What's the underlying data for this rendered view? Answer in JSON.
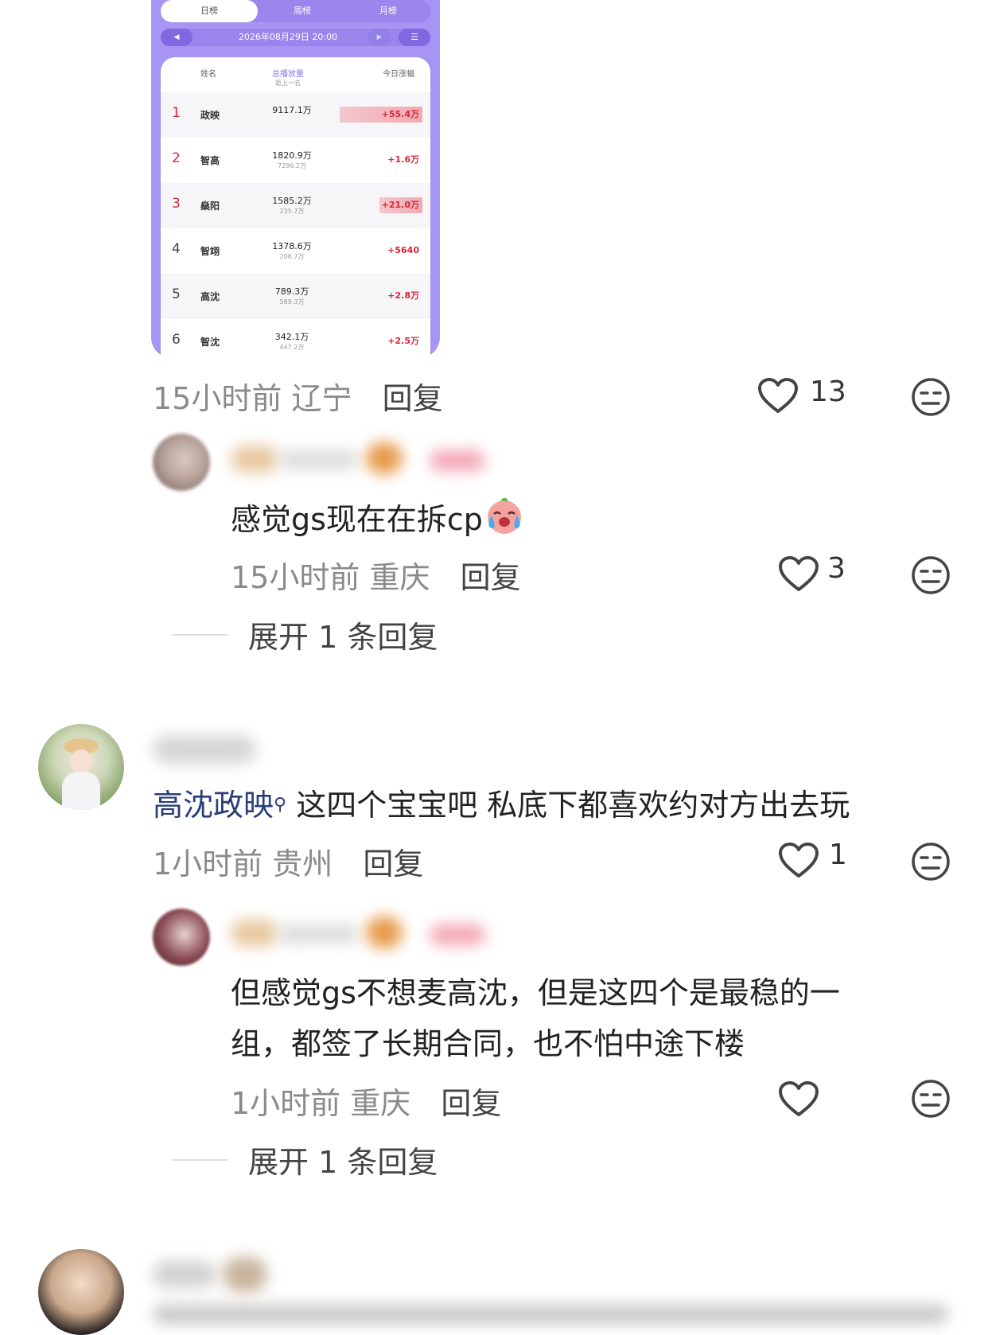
{
  "ranking_card": {
    "tabs": {
      "day": "日榜",
      "week": "周榜",
      "month": "月榜"
    },
    "date": "2026年08月29日 20:00",
    "headers": {
      "name": "姓名",
      "total": "总播放量",
      "total_sub": "距上一名",
      "today": "今日涨幅"
    },
    "rows": [
      {
        "rank": "1",
        "name": "政映",
        "total": "9117.1万",
        "gap": "",
        "today": "+55.4万"
      },
      {
        "rank": "2",
        "name": "智高",
        "total": "1820.9万",
        "gap": "7296.2万",
        "today": "+1.6万"
      },
      {
        "rank": "3",
        "name": "燊阳",
        "total": "1585.2万",
        "gap": "235.7万",
        "today": "+21.0万"
      },
      {
        "rank": "4",
        "name": "智翊",
        "total": "1378.6万",
        "gap": "206.7万",
        "today": "+5640"
      },
      {
        "rank": "5",
        "name": "高沈",
        "total": "789.3万",
        "gap": "589.3万",
        "today": "+2.8万"
      },
      {
        "rank": "6",
        "name": "智沈",
        "total": "342.1万",
        "gap": "447.2万",
        "today": "+2.5万"
      }
    ]
  },
  "comments": {
    "c1": {
      "time": "15小时前",
      "location": "辽宁",
      "reply": "回复",
      "likes": "13"
    },
    "r1": {
      "text": "感觉gs现在在拆cp",
      "time": "15小时前",
      "location": "重庆",
      "reply": "回复",
      "likes": "3"
    },
    "expand1": "展开 1 条回复",
    "c2": {
      "mention": "高沈政映",
      "text": " 这四个宝宝吧 私底下都喜欢约对方出去玩",
      "time": "1小时前",
      "location": "贵州",
      "reply": "回复",
      "likes": "1"
    },
    "r2": {
      "line1": "但感觉gs不想麦高沈，但是这四个是最稳的一",
      "line2": "组，都签了长期合同，也不怕中途下楼",
      "time": "1小时前",
      "location": "重庆",
      "reply": "回复"
    },
    "expand2": "展开 1 条回复"
  },
  "icons": [
    "heart-icon",
    "neutral-face-icon",
    "search-icon",
    "crying-emoji"
  ],
  "colors": {
    "accent": "#a894f2",
    "rank_red": "#d8263b",
    "mention": "#2a3f7a"
  }
}
